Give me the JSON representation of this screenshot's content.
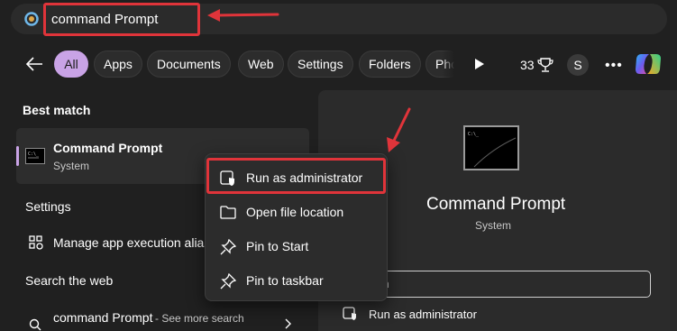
{
  "search": {
    "query": "command Prompt"
  },
  "tabs": [
    {
      "label": "All",
      "active": true
    },
    {
      "label": "Apps"
    },
    {
      "label": "Documents"
    },
    {
      "label": "Web"
    },
    {
      "label": "Settings"
    },
    {
      "label": "Folders"
    },
    {
      "label": "Pho"
    }
  ],
  "toolbar": {
    "count": "33",
    "avatar": "S",
    "more": "•••"
  },
  "best_match": {
    "heading": "Best match",
    "title": "Command Prompt",
    "subtitle": "System"
  },
  "settings": {
    "heading": "Settings",
    "item": "Manage app execution alias"
  },
  "web": {
    "heading": "Search the web",
    "query": "command Prompt",
    "suffix": " - See more search"
  },
  "detail": {
    "title": "Command Prompt",
    "subtitle": "System",
    "open_label": "en",
    "run_admin": "Run as administrator"
  },
  "context_menu": {
    "items": [
      {
        "label": "Run as administrator",
        "icon": "shield-icon"
      },
      {
        "label": "Open file location",
        "icon": "folder-icon"
      },
      {
        "label": "Pin to Start",
        "icon": "pin-icon"
      },
      {
        "label": "Pin to taskbar",
        "icon": "pin-icon"
      }
    ]
  },
  "colors": {
    "accent": "#c9a3e6",
    "annotation": "#e0343a",
    "background": "#202020",
    "panel": "#2b2b2b"
  }
}
